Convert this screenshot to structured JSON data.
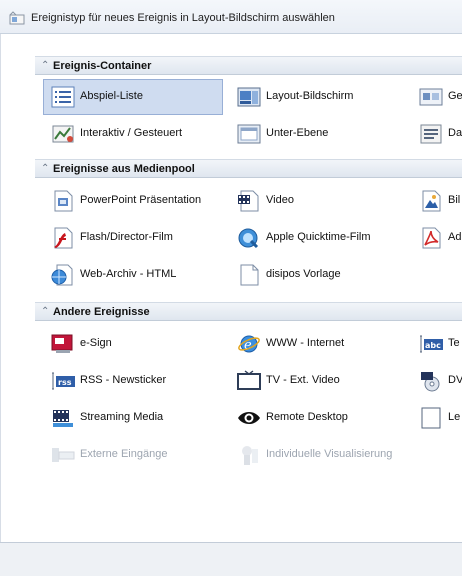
{
  "window": {
    "title": "Ereignistyp für neues Ereignis in Layout-Bildschirm auswählen"
  },
  "sections": [
    {
      "label": "Ereignis-Container",
      "items": [
        {
          "label": "Abspiel-Liste",
          "icon": "playlist-icon",
          "selected": true,
          "disabled": false
        },
        {
          "label": "Layout-Bildschirm",
          "icon": "layout-screen-icon",
          "selected": false,
          "disabled": false
        },
        {
          "label": "Ge",
          "icon": "screen-group-icon",
          "selected": false,
          "disabled": false
        },
        {
          "label": "Interaktiv / Gesteuert",
          "icon": "interactive-icon",
          "selected": false,
          "disabled": false
        },
        {
          "label": "Unter-Ebene",
          "icon": "sub-layer-icon",
          "selected": false,
          "disabled": false
        },
        {
          "label": "Da",
          "icon": "data-icon",
          "selected": false,
          "disabled": false
        }
      ]
    },
    {
      "label": "Ereignisse aus Medienpool",
      "items": [
        {
          "label": "PowerPoint Präsentation",
          "icon": "powerpoint-icon",
          "selected": false,
          "disabled": false
        },
        {
          "label": "Video",
          "icon": "video-file-icon",
          "selected": false,
          "disabled": false
        },
        {
          "label": "Bil",
          "icon": "image-file-icon",
          "selected": false,
          "disabled": false
        },
        {
          "label": "Flash/Director-Film",
          "icon": "flash-icon",
          "selected": false,
          "disabled": false
        },
        {
          "label": "Apple Quicktime-Film",
          "icon": "quicktime-icon",
          "selected": false,
          "disabled": false
        },
        {
          "label": "Ad",
          "icon": "pdf-icon",
          "selected": false,
          "disabled": false
        },
        {
          "label": "Web-Archiv - HTML",
          "icon": "web-archive-icon",
          "selected": false,
          "disabled": false
        },
        {
          "label": "disipos Vorlage",
          "icon": "template-file-icon",
          "selected": false,
          "disabled": false
        }
      ]
    },
    {
      "label": "Andere Ereignisse",
      "items": [
        {
          "label": "e-Sign",
          "icon": "esign-icon",
          "selected": false,
          "disabled": false
        },
        {
          "label": "WWW - Internet",
          "icon": "internet-icon",
          "selected": false,
          "disabled": false
        },
        {
          "label": "Te",
          "icon": "text-icon",
          "selected": false,
          "disabled": false
        },
        {
          "label": "RSS - Newsticker",
          "icon": "rss-icon",
          "selected": false,
          "disabled": false
        },
        {
          "label": "TV - Ext. Video",
          "icon": "tv-icon",
          "selected": false,
          "disabled": false
        },
        {
          "label": "DV",
          "icon": "dvd-icon",
          "selected": false,
          "disabled": false
        },
        {
          "label": "Streaming Media",
          "icon": "streaming-icon",
          "selected": false,
          "disabled": false
        },
        {
          "label": "Remote Desktop",
          "icon": "eye-icon",
          "selected": false,
          "disabled": false
        },
        {
          "label": "Le",
          "icon": "blank-icon",
          "selected": false,
          "disabled": false
        },
        {
          "label": "Externe Eingänge",
          "icon": "external-input-icon",
          "selected": false,
          "disabled": true
        },
        {
          "label": "Individuelle Visualisierung",
          "icon": "visualization-icon",
          "selected": false,
          "disabled": true
        }
      ]
    }
  ]
}
